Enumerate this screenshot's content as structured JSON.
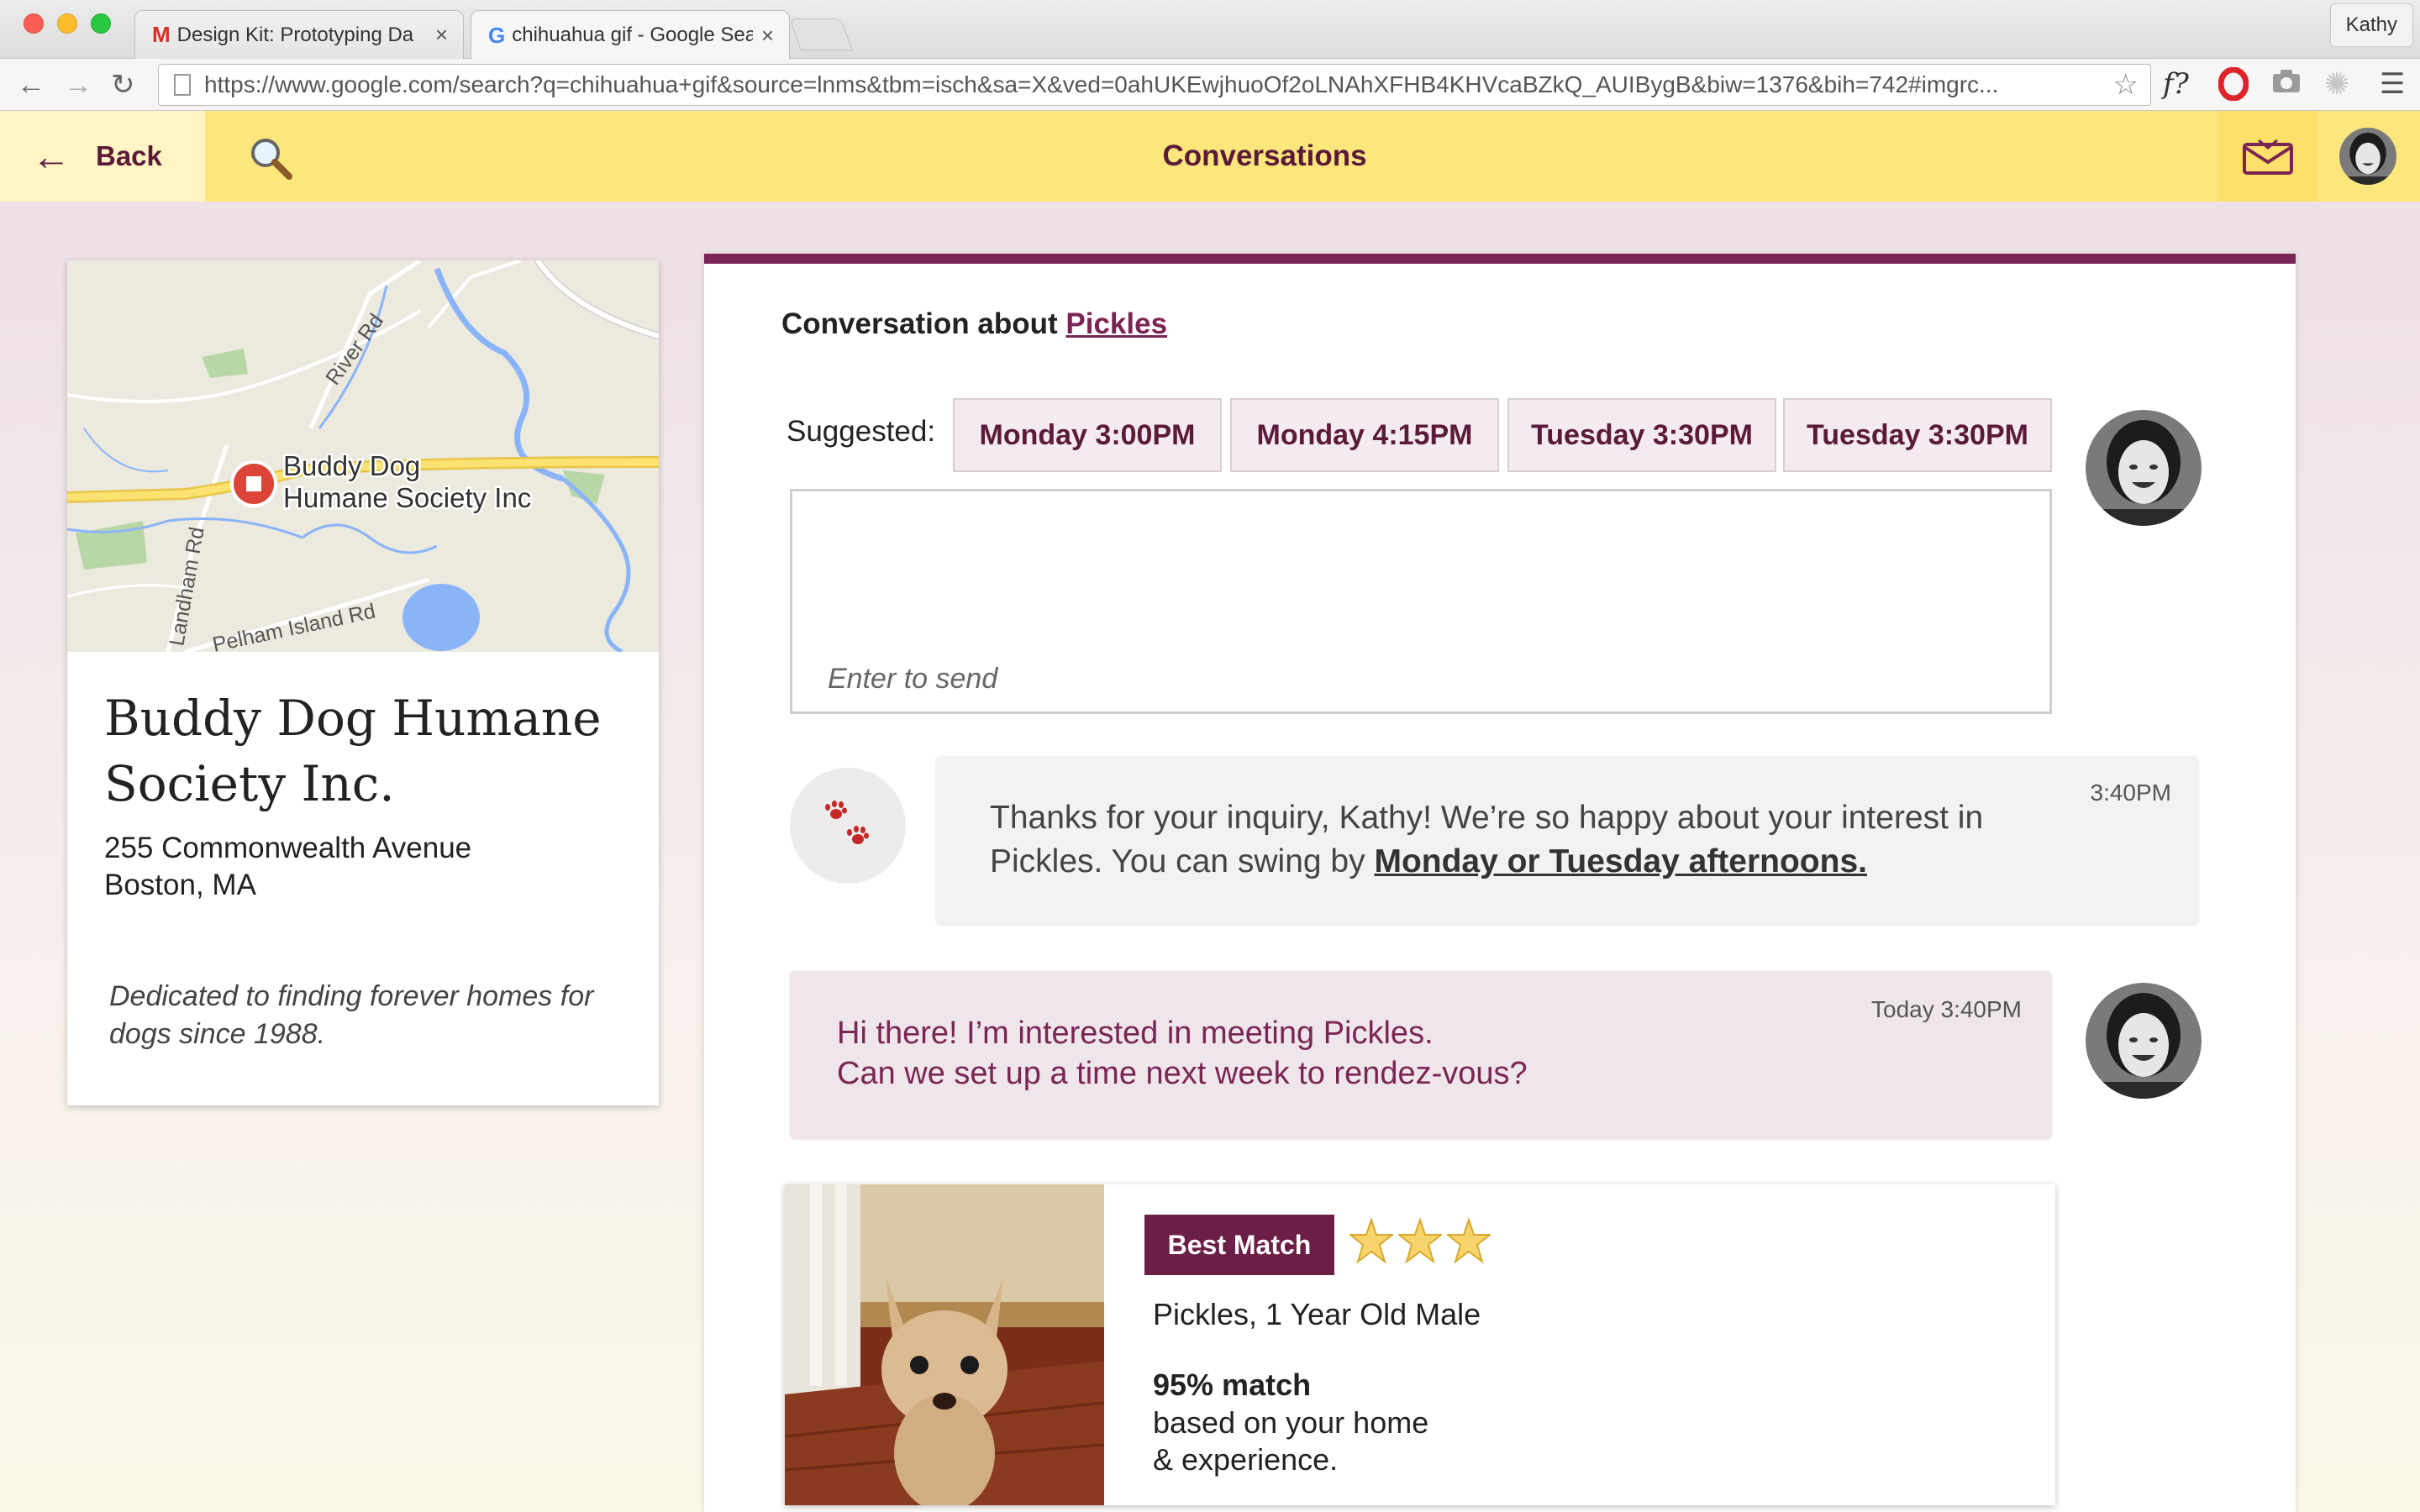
{
  "browser": {
    "tabs": [
      {
        "favicon": "gmail-icon",
        "title": "Design Kit: Prototyping Da"
      },
      {
        "favicon": "google-icon",
        "title": "chihuahua gif - Google Sea"
      }
    ],
    "profile": "Kathy",
    "url": "https://www.google.com/search?q=chihuahua+gif&source=lnms&tbm=isch&sa=X&ved=0ahUKEwjhuoOf2oLNAhXFHB4KHVcaBZkQ_AUIBygB&biw=1376&bih=742#imgrc...",
    "extensions": [
      "font-finder-icon",
      "opera-icon",
      "camera-icon",
      "settings-icon",
      "menu-icon"
    ]
  },
  "header": {
    "back_label": "Back",
    "title": "Conversations"
  },
  "org": {
    "name": "Buddy Dog Humane Society Inc.",
    "address_line1": "255 Commonwealth Avenue",
    "address_line2": "Boston, MA",
    "description": "Dedicated to finding forever homes for dogs since 1988.",
    "map": {
      "marker_label_line1": "Buddy Dog",
      "marker_label_line2": "Humane Society Inc",
      "roads": [
        "River Rd",
        "Landham Rd",
        "Pelham Island Rd"
      ]
    }
  },
  "conversation": {
    "heading_prefix": "Conversation about",
    "pet_link": "Pickles",
    "suggested_label": "Suggested:",
    "suggested_times": [
      "Monday 3:00PM",
      "Monday 4:15PM",
      "Tuesday 3:30PM",
      "Tuesday 3:30PM"
    ],
    "compose_placeholder": "Enter to send",
    "messages": [
      {
        "from": "shelter",
        "text_before": "Thanks for your inquiry, Kathy! We’re so happy about your interest in Pickles. You can swing by",
        "text_link": "Monday or Tuesday afternoons.",
        "time": "3:40PM"
      },
      {
        "from": "user",
        "text": "Hi there! I’m interested in meeting Pickles.\nCan we set up a time next week to rendez-vous?",
        "time": "Today 3:40PM"
      }
    ]
  },
  "match": {
    "badge": "Best Match",
    "stars": 3,
    "pet_line": "Pickles, 1 Year Old Male",
    "percent": "95% match",
    "reason": "based on your home\n& experience."
  },
  "colors": {
    "accent": "#7a2553",
    "header_bg": "#fde77c",
    "badge_bg": "#6b1f47"
  }
}
